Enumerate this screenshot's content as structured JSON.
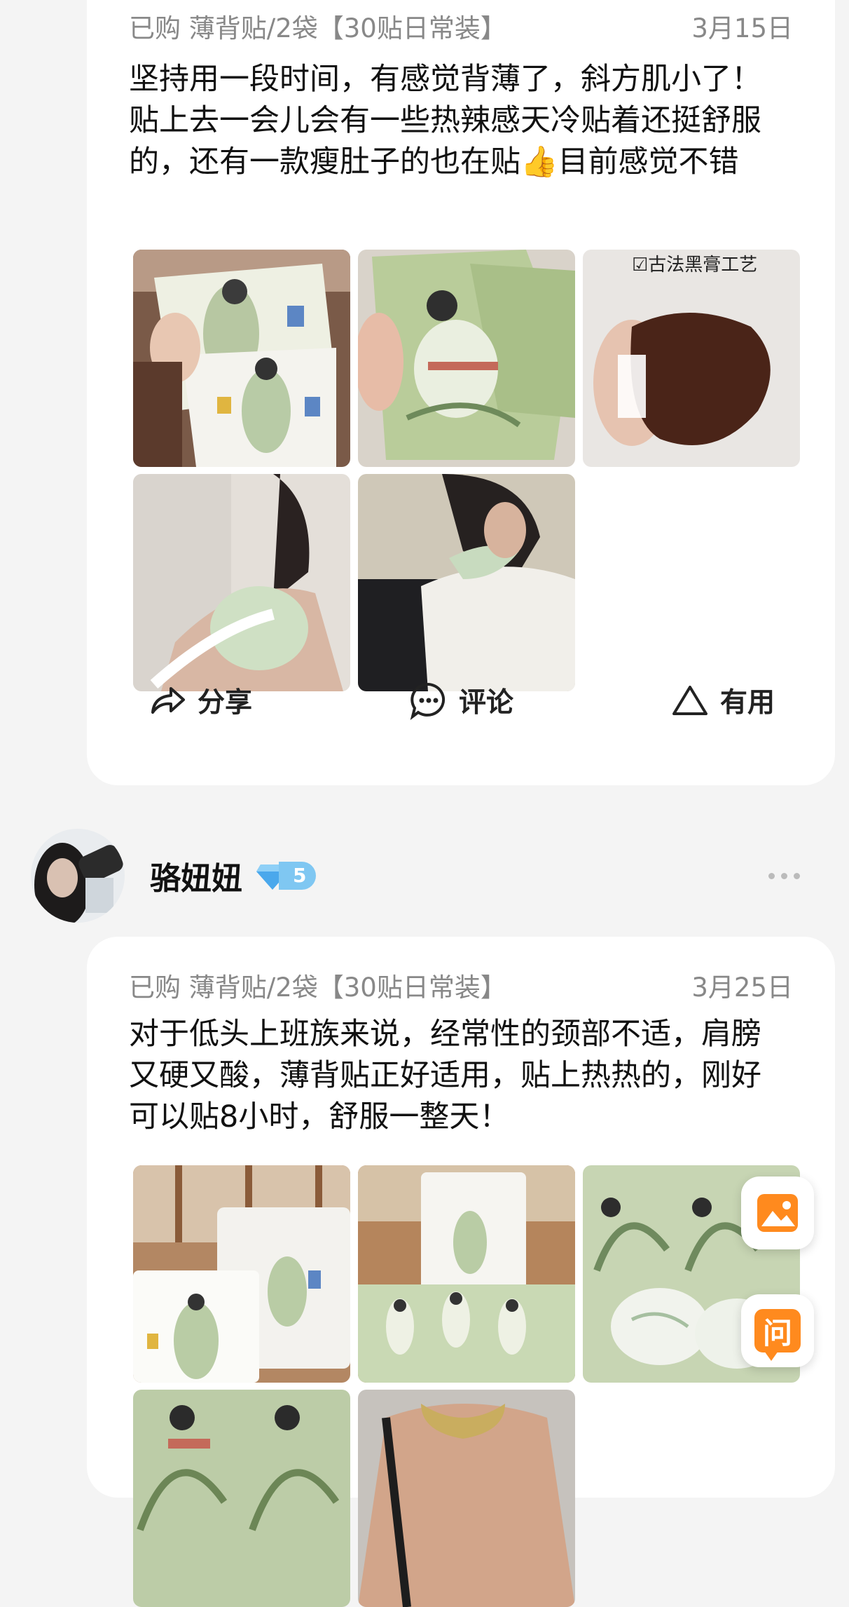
{
  "review1": {
    "purchase_info": "已购 薄背贴/2袋【30贴日常装】",
    "date": "3月15日",
    "text": "坚持用一段时间，有感觉背薄了，斜方肌小了！贴上去一会儿会有一些热辣感天冷贴着还挺舒服的，还有一款瘦肚子的也在贴👍目前感觉不错",
    "photo_caption": "☑古法黑膏工艺",
    "actions": {
      "share": "分享",
      "comment": "评论",
      "useful": "有用"
    }
  },
  "review2_user": {
    "name": "骆妞妞",
    "level": "5"
  },
  "review2": {
    "purchase_info": "已购 薄背贴/2袋【30贴日常装】",
    "date": "3月25日",
    "text": "对于低头上班族来说，经常性的颈部不适，肩膀又硬又酸，薄背贴正好适用，贴上热热的，刚好可以贴8小时，舒服一整天！"
  },
  "floating": {
    "ask_label": "问"
  },
  "colors": {
    "accent_orange": "#ff8a1e",
    "level_badge": "#7fc7f2"
  }
}
